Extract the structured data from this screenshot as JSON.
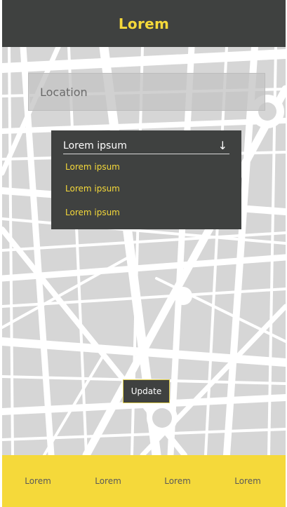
{
  "header": {
    "title": "Lorem"
  },
  "search": {
    "placeholder": "Location"
  },
  "dropdown": {
    "selected": "Lorem ipsum",
    "expand_icon": "arrow-down-icon",
    "options": [
      "Lorem ipsum",
      "Lorem ipsum",
      "Lorem ipsum"
    ]
  },
  "actions": {
    "update_label": "Update"
  },
  "bottom_nav": {
    "items": [
      {
        "label": "Lorem"
      },
      {
        "label": "Lorem"
      },
      {
        "label": "Lorem"
      },
      {
        "label": "Lorem"
      }
    ]
  },
  "colors": {
    "header_bg": "#3f4140",
    "accent": "#f5d93a",
    "map_block": "#d6d6d6",
    "map_road": "#ffffff"
  }
}
